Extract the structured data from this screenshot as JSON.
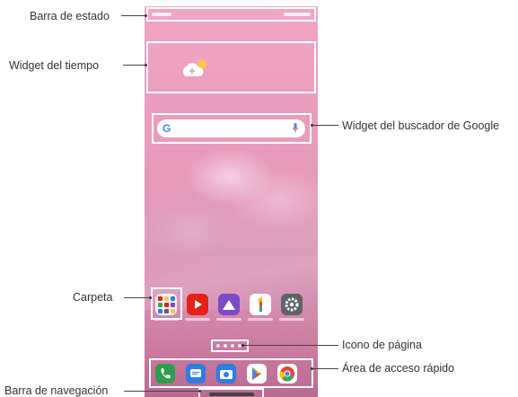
{
  "labels": {
    "status_bar": "Barra de estado",
    "weather_widget": "Widget del tiempo",
    "google_widget": "Widget del buscador de Google",
    "folder": "Carpeta",
    "page_icon": "Icono de página",
    "quick_access": "Área de acceso rápido",
    "nav_bar": "Barra de navegación"
  },
  "search": {
    "logo_text": "G"
  },
  "icons": {
    "weather": "cloud-sun-icon",
    "mic": "mic-icon",
    "apps": [
      "folder-icon",
      "youtube-icon",
      "gallery-icon",
      "google-one-icon",
      "settings-icon"
    ],
    "dock": [
      "phone-icon",
      "messages-icon",
      "camera-icon",
      "play-store-icon",
      "chrome-icon"
    ]
  },
  "colors": {
    "wallpaper_top": "#f0a7c3",
    "wallpaper_bottom": "#b86a92",
    "highlight_box": "#ffffff",
    "label_text": "#333333",
    "youtube": "#e62117",
    "gallery": "#7b4cc7",
    "settings": "#5f6368",
    "phone": "#2e9e4c",
    "messages": "#2f7de1",
    "camera": "#2f7de1"
  }
}
